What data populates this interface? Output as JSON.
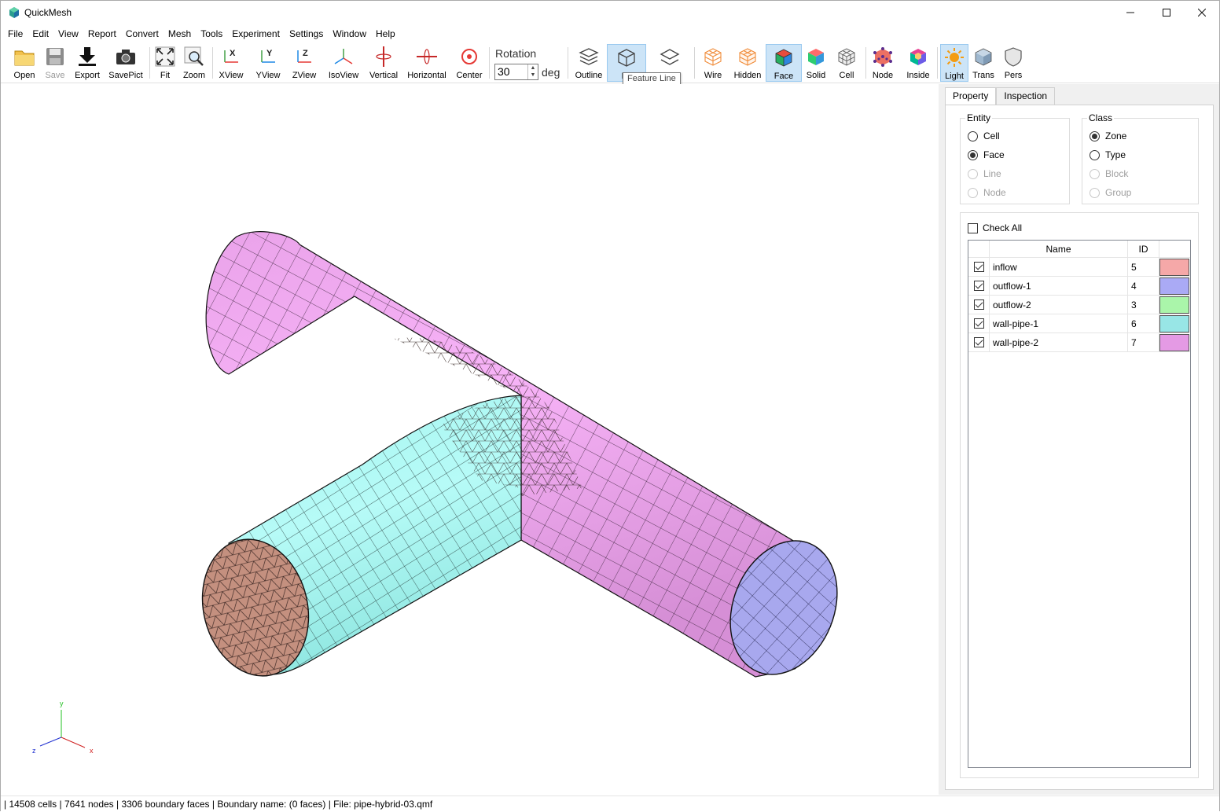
{
  "window": {
    "title": "QuickMesh"
  },
  "menu": [
    "File",
    "Edit",
    "View",
    "Report",
    "Convert",
    "Mesh",
    "Tools",
    "Experiment",
    "Settings",
    "Window",
    "Help"
  ],
  "toolbar": {
    "open": "Open",
    "save": "Save",
    "export": "Export",
    "savepict": "SavePict",
    "fit": "Fit",
    "zoom": "Zoom",
    "xview": "XView",
    "yview": "YView",
    "zview": "ZView",
    "isoview": "IsoView",
    "vertical": "Vertical",
    "horizontal": "Horizontal",
    "center": "Center",
    "rotation_label": "Rotation",
    "rotation_value": "30",
    "rotation_unit": "deg",
    "outline": "Outline",
    "feature_line": "Fe",
    "bnd_edge": "",
    "wire": "Wire",
    "hidden": "Hidden",
    "face": "Face",
    "solid": "Solid",
    "cell": "Cell",
    "node": "Node",
    "inside": "Inside",
    "light": "Light",
    "trans": "Trans",
    "pers": "Pers",
    "tooltip": "Feature Line"
  },
  "tabs": [
    "Property",
    "Inspection"
  ],
  "entity": {
    "title": "Entity",
    "options": [
      {
        "label": "Cell",
        "checked": false,
        "enabled": true
      },
      {
        "label": "Face",
        "checked": true,
        "enabled": true
      },
      {
        "label": "Line",
        "checked": false,
        "enabled": false
      },
      {
        "label": "Node",
        "checked": false,
        "enabled": false
      }
    ]
  },
  "class": {
    "title": "Class",
    "options": [
      {
        "label": "Zone",
        "checked": true,
        "enabled": true
      },
      {
        "label": "Type",
        "checked": false,
        "enabled": true
      },
      {
        "label": "Block",
        "checked": false,
        "enabled": false
      },
      {
        "label": "Group",
        "checked": false,
        "enabled": false
      }
    ]
  },
  "check_all": "Check All",
  "zone_table": {
    "headers": [
      "Name",
      "ID"
    ],
    "rows": [
      {
        "name": "inflow",
        "id": "5",
        "color": "#f5a8a8",
        "checked": true
      },
      {
        "name": "outflow-1",
        "id": "4",
        "color": "#aaaaf5",
        "checked": true
      },
      {
        "name": "outflow-2",
        "id": "3",
        "color": "#aaf5aa",
        "checked": true
      },
      {
        "name": "wall-pipe-1",
        "id": "6",
        "color": "#98e6e6",
        "checked": true
      },
      {
        "name": "wall-pipe-2",
        "id": "7",
        "color": "#e49ae4",
        "checked": true
      }
    ]
  },
  "axes": {
    "x": "x",
    "y": "y",
    "z": "z"
  },
  "status": "| 14508 cells | 7641 nodes | 3306 boundary faces |  Boundary name:  (0 faces) | File: pipe-hybrid-03.qmf",
  "colors": {
    "pipe_main": "#f4a7f4",
    "pipe_branch": "#a6f5f0",
    "inlet_face": "#c08c80",
    "outlet_face": "#a8a8ee",
    "accent_active": "#cce4f7"
  }
}
